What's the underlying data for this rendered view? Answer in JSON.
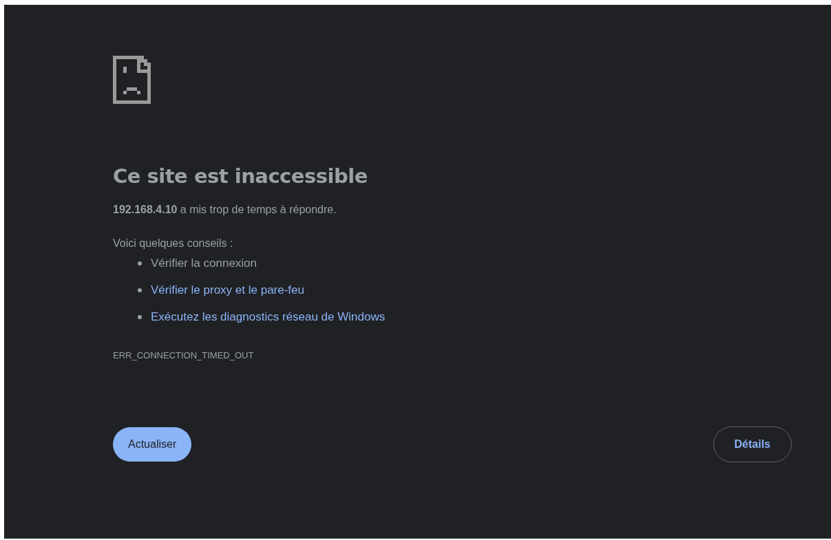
{
  "heading": "Ce site est inaccessible",
  "message": "**192.168.4.10** a mis trop de temps à répondre.",
  "suggestions_intro": "Voici quelques conseils :",
  "suggestions": [
    {
      "kind": "text",
      "label": "Vérifier la connexion"
    },
    {
      "kind": "link",
      "label": "Vérifier le proxy et le pare-feu"
    },
    {
      "kind": "link",
      "label": "Exécutez les diagnostics réseau de Windows"
    }
  ],
  "error_code": "ERR_CONNECTION_TIMED_OUT",
  "buttons": [
    {
      "kind": "primary",
      "label": "Actualiser"
    },
    {
      "kind": "outline",
      "label": "Détails"
    }
  ]
}
